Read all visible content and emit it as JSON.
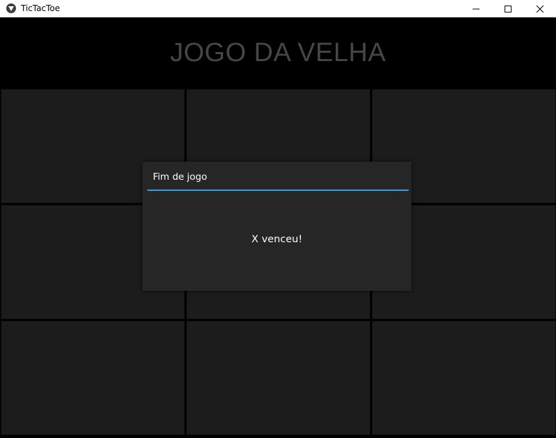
{
  "window": {
    "title": "TicTacToe",
    "app_icon": "kivy-logo-icon",
    "controls": [
      "minimize-icon",
      "maximize-icon",
      "close-icon"
    ]
  },
  "header": {
    "title": "JOGO DA VELHA"
  },
  "board": {
    "cells": [
      "",
      "",
      "",
      "",
      "",
      "",
      "",
      "",
      ""
    ]
  },
  "dialog": {
    "title": "Fim de jogo",
    "message": "X venceu!",
    "accent_color": "#3a9bd7"
  },
  "colors": {
    "background": "#000000",
    "cell": "#1c1c1c",
    "title_text": "#464646",
    "dialog_bg": "#262626"
  }
}
